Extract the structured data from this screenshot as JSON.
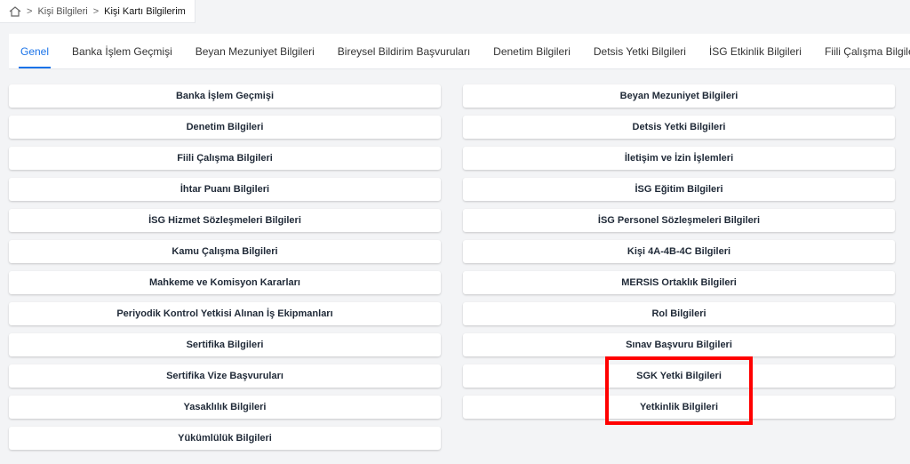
{
  "breadcrumb": {
    "items": [
      "Kişi Bilgileri",
      "Kişi Kartı Bilgilerim"
    ],
    "separator": ">"
  },
  "tabs": [
    {
      "label": "Genel",
      "active": true
    },
    {
      "label": "Banka İşlem Geçmişi"
    },
    {
      "label": "Beyan Mezuniyet Bilgileri"
    },
    {
      "label": "Bireysel Bildirim Başvuruları"
    },
    {
      "label": "Denetim Bilgileri"
    },
    {
      "label": "Detsis Yetki Bilgileri"
    },
    {
      "label": "İSG Etkinlik Bilgileri"
    },
    {
      "label": "Fiili Çalışma Bilgileri"
    }
  ],
  "cards": [
    "Banka İşlem Geçmişi",
    "Beyan Mezuniyet Bilgileri",
    "Denetim Bilgileri",
    "Detsis Yetki Bilgileri",
    "Fiili Çalışma Bilgileri",
    "İletişim ve İzin İşlemleri",
    "İhtar Puanı Bilgileri",
    "İSG Eğitim Bilgileri",
    "İSG Hizmet Sözleşmeleri Bilgileri",
    "İSG Personel Sözleşmeleri Bilgileri",
    "Kamu Çalışma Bilgileri",
    "Kişi 4A-4B-4C Bilgileri",
    "Mahkeme ve Komisyon Kararları",
    "MERSIS Ortaklık Bilgileri",
    "Periyodik Kontrol Yetkisi Alınan İş Ekipmanları",
    "Rol Bilgileri",
    "Sertifika Bilgileri",
    "Sınav Başvuru Bilgileri",
    "Sertifika Vize Başvuruları",
    "SGK Yetki Bilgileri",
    "Yasaklılık Bilgileri",
    "Yetkinlik Bilgileri",
    "Yükümlülük Bilgileri"
  ],
  "colors": {
    "accent": "#1a73e8",
    "highlight": "#ff0000"
  },
  "icons": {
    "home": "home-icon"
  }
}
